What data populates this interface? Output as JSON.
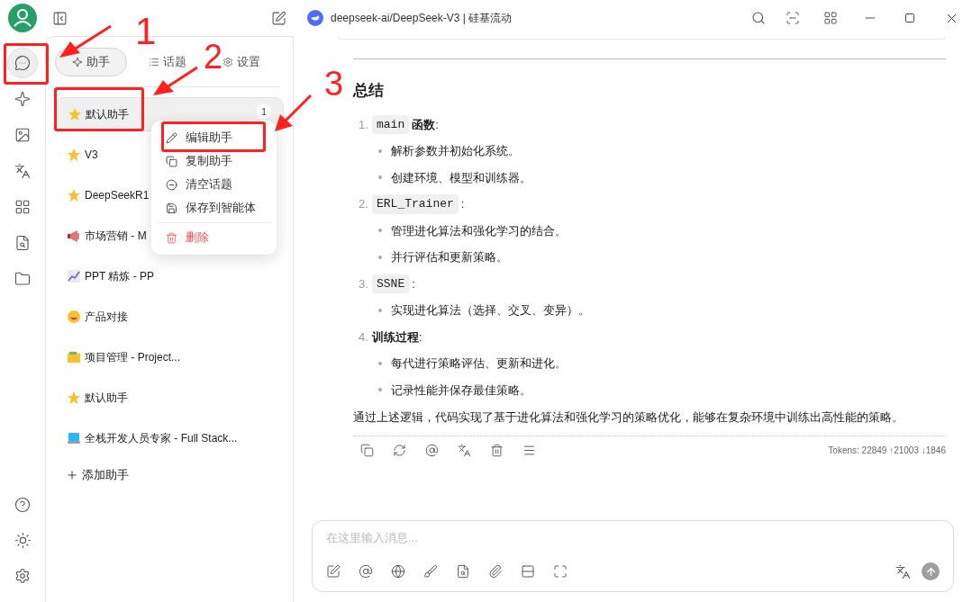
{
  "title_bar": {
    "title": "deepseek-ai/DeepSeek-V3 | 硅基流动"
  },
  "nav_rail": {
    "top": [
      {
        "selected": true
      },
      {
        "selected": false
      },
      {
        "selected": false
      },
      {
        "selected": false
      },
      {
        "selected": false
      },
      {
        "selected": false
      },
      {
        "selected": false
      }
    ]
  },
  "tabs": [
    {
      "label": "助手",
      "selected": true
    },
    {
      "label": "话题",
      "selected": false
    },
    {
      "label": "设置",
      "selected": false
    }
  ],
  "assistants": [
    {
      "name": "默认助手",
      "selected": true,
      "badge": "1"
    },
    {
      "name": "V3",
      "selected": false
    },
    {
      "name": "DeepSeekR1",
      "selected": false
    },
    {
      "name": "市场营销 - M",
      "selected": false
    },
    {
      "name": "PPT 精炼 - PP",
      "selected": false
    },
    {
      "name": "产品对接",
      "selected": false
    },
    {
      "name": "项目管理 - Project...",
      "selected": false
    },
    {
      "name": "默认助手",
      "selected": false
    },
    {
      "name": "全栈开发人员专家 - Full Stack...",
      "selected": false
    }
  ],
  "add_assistant": "添加助手",
  "context_menu": [
    {
      "label": "编辑助手",
      "kind": "normal"
    },
    {
      "label": "复制助手",
      "kind": "normal"
    },
    {
      "label": "清空话题",
      "kind": "normal"
    },
    {
      "label": "保存到智能体",
      "kind": "normal"
    },
    {
      "label": "删除",
      "kind": "danger"
    }
  ],
  "message": {
    "heading": "总结",
    "items": [
      {
        "number": "1.",
        "code": "main",
        "text": "**函数**:",
        "bullets": [
          "解析参数并初始化系统。",
          "创建环境、模型和训练器。"
        ]
      },
      {
        "number": "2.",
        "code": "ERL_Trainer",
        "text": ":",
        "bullets": [
          "管理进化算法和强化学习的结合。",
          "并行评估和更新策略。"
        ]
      },
      {
        "number": "3.",
        "code": "SSNE",
        "text": ":",
        "bullets": [
          "实现进化算法（选择、交叉、变异）。"
        ]
      },
      {
        "number": "4.",
        "text": "**训练过程**:",
        "bullets": [
          "每代进行策略评估、更新和进化。",
          "记录性能并保存最佳策略。"
        ]
      }
    ],
    "summary": "通过上述逻辑，代码实现了基于进化算法和强化学习的策略优化，能够在复杂环境中训练出高性能的策略。",
    "tokens": "Tokens: 22849 ↑21003 ↓1846"
  },
  "input": {
    "placeholder": "在这里输入消息..."
  },
  "annotations": {
    "labels": [
      "1",
      "2",
      "3"
    ]
  }
}
